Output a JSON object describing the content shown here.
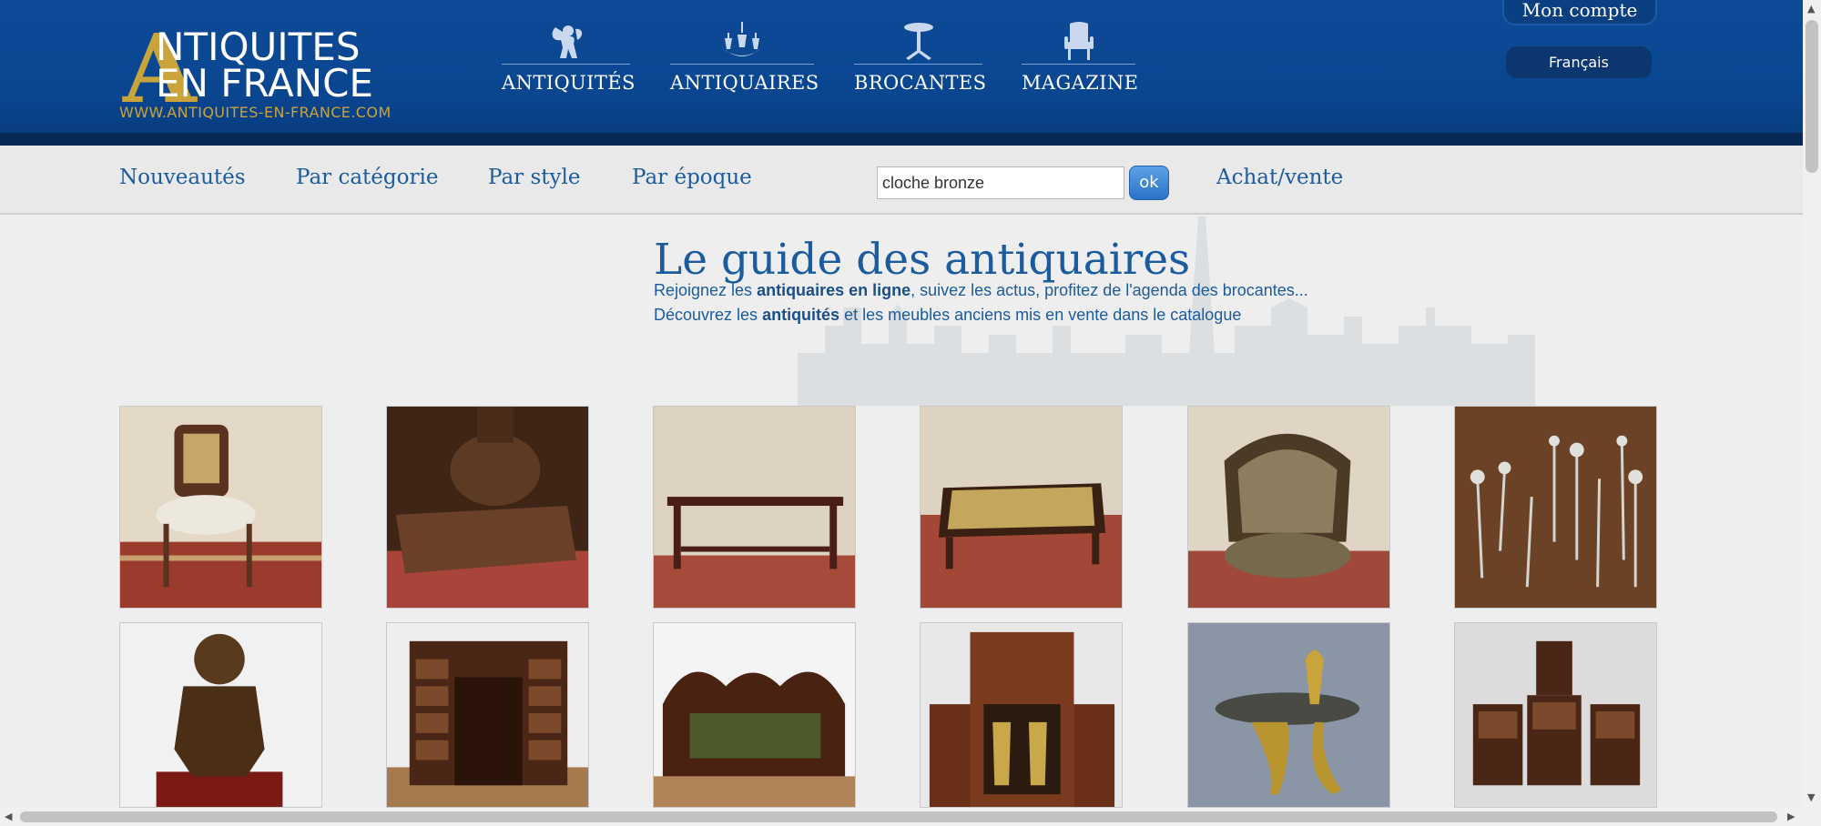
{
  "header": {
    "logo": {
      "letter": "A",
      "line1": "NTIQUITES",
      "line2": "EN FRANCE",
      "url": "WWW.ANTIQUITES-EN-FRANCE.COM"
    },
    "nav": [
      {
        "label": "ANTIQUITÉS",
        "icon": "cherub-icon"
      },
      {
        "label": "ANTIQUAIRES",
        "icon": "chandelier-icon"
      },
      {
        "label": "BROCANTES",
        "icon": "pedestal-table-icon"
      },
      {
        "label": "MAGAZINE",
        "icon": "armchair-icon"
      }
    ],
    "account": "Mon compte",
    "language": "Français"
  },
  "subnav": {
    "links": [
      "Nouveautés",
      "Par catégorie",
      "Par style",
      "Par époque"
    ],
    "search_value": "cloche bronze",
    "ok": "ok",
    "buy_sell": "Achat/vente"
  },
  "intro": {
    "title": "Le guide des antiquaires",
    "line1_pre": "Rejoignez les ",
    "line1_bold": "antiquaires en ligne",
    "line1_post": ", suivez les actus, profitez de l'agenda des brocantes...",
    "line2_pre": "Découvrez les ",
    "line2_bold": "antiquités",
    "line2_post": " et les meubles anciens mis en vente dans le catalogue"
  },
  "products": [
    {
      "subject": "cane-back-chair-photo"
    },
    {
      "subject": "carved-pedestal-photo"
    },
    {
      "subject": "console-table-photo"
    },
    {
      "subject": "low-lacquer-table-photo"
    },
    {
      "subject": "upholstered-armchair-photo"
    },
    {
      "subject": "silver-hatpins-photo"
    },
    {
      "subject": "bronze-figure-photo"
    },
    {
      "subject": "pedestal-desk-photo"
    },
    {
      "subject": "restauration-sofa-photo"
    },
    {
      "subject": "liquor-cabinet-photo"
    },
    {
      "subject": "art-nouveau-dish-photo"
    },
    {
      "subject": "leather-chairs-set-photo"
    }
  ],
  "colors": {
    "header_blue": "#0a4690",
    "link_blue": "#1b5b9e",
    "logo_gold": "#c9a43b"
  }
}
